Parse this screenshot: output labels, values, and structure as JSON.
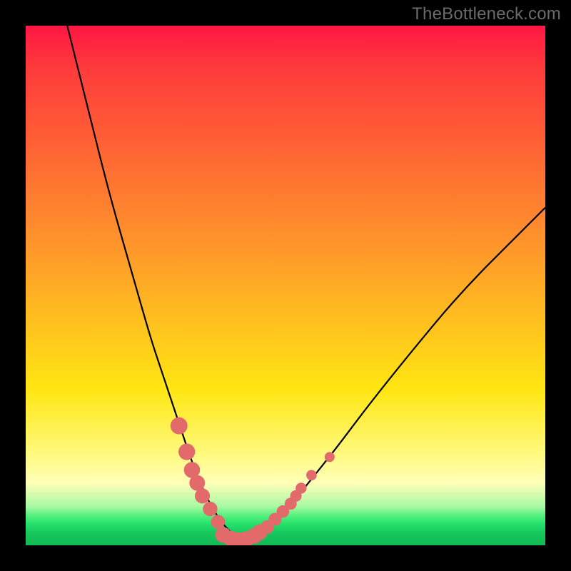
{
  "watermark": "TheBottleneck.com",
  "chart_data": {
    "type": "line",
    "title": "",
    "xlabel": "",
    "ylabel": "",
    "xlim": [
      0,
      100
    ],
    "ylim": [
      0,
      100
    ],
    "grid": false,
    "legend": false,
    "series": [
      {
        "name": "bottleneck-curve",
        "color": "#000000",
        "x": [
          8,
          12,
          16,
          20,
          24,
          26,
          28,
          30,
          32,
          34,
          36,
          38,
          40,
          42,
          44,
          48,
          52,
          56,
          60,
          66,
          74,
          84,
          96,
          100
        ],
        "y": [
          100,
          84,
          68,
          54,
          40,
          34,
          28,
          22,
          16,
          11,
          7,
          4,
          2,
          1,
          2,
          5,
          9,
          14,
          19,
          27,
          37,
          49,
          61,
          65
        ]
      }
    ],
    "markers": [
      {
        "name": "highlighted-points",
        "color": "#e26a6a",
        "x": [
          29.5,
          31,
          32,
          33,
          34,
          35.5,
          37,
          46.5,
          48,
          49.5,
          51,
          52,
          53,
          55,
          58.5
        ],
        "y": [
          23,
          18,
          14.5,
          12,
          9.5,
          7,
          4.5,
          3.5,
          5,
          6.5,
          8,
          9.5,
          11,
          13.5,
          17
        ],
        "size_start": 12,
        "size_end": 7
      },
      {
        "name": "bottom-band",
        "color": "#e26a6a",
        "x": [
          38,
          39.5,
          41,
          42.5,
          44,
          45
        ],
        "y": [
          2,
          1.3,
          1,
          1.2,
          1.8,
          2.5
        ],
        "size": 11
      }
    ]
  }
}
